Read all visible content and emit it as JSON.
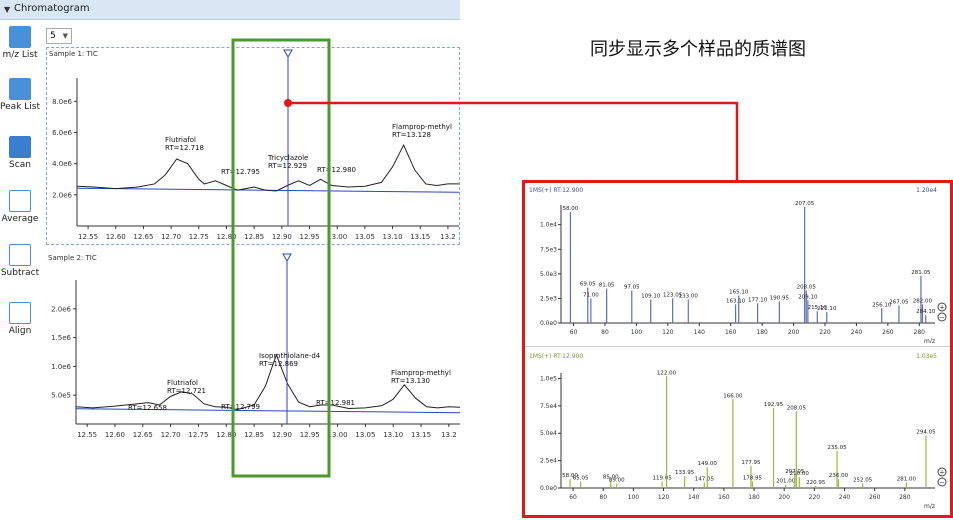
{
  "window": {
    "title": "Chromatogram"
  },
  "toolbar": {
    "items": [
      {
        "label": "m/z List",
        "icon": "mz-list-icon"
      },
      {
        "label": "Peak List",
        "icon": "peak-list-icon"
      },
      {
        "label": "Scan",
        "icon": "scan-icon"
      },
      {
        "label": "Average",
        "icon": "average-icon"
      },
      {
        "label": "Subtract",
        "icon": "subtract-icon"
      },
      {
        "label": "Align",
        "icon": "align-icon"
      }
    ]
  },
  "sample_count": {
    "value": "5"
  },
  "heading": "同步显示多个样品的质谱图",
  "colors": {
    "accent": "#4a90d9",
    "green_box": "#4a9a2e",
    "red_box": "#e0181c",
    "ms2_line": "#9ab83a"
  },
  "chart_data": [
    {
      "type": "line",
      "title": "Sample 1: TIC",
      "x_ticks": [
        "12.55",
        "12.60",
        "12.65",
        "12.70",
        "12.75",
        "12.80",
        "12.85",
        "12.90",
        "12.95",
        "13.00",
        "13.05",
        "13.10",
        "13.15",
        "13.2"
      ],
      "y_ticks": [
        "2.0e6",
        "4.0e6",
        "6.0e6",
        "8.0e6"
      ],
      "xlim": [
        12.53,
        13.22
      ],
      "ylim": [
        0,
        9500000
      ],
      "series": [
        {
          "x": [
            12.53,
            12.56,
            12.6,
            12.64,
            12.67,
            12.69,
            12.71,
            12.73,
            12.75,
            12.76,
            12.78,
            12.8,
            12.82,
            12.85,
            12.87,
            12.89,
            12.91,
            12.93,
            12.95,
            12.97,
            12.99,
            13.02,
            13.05,
            13.08,
            13.1,
            13.12,
            13.14,
            13.16,
            13.18,
            13.2,
            13.22
          ],
          "y": [
            2550000,
            2500000,
            2400000,
            2500000,
            2700000,
            3300000,
            4300000,
            4000000,
            3000000,
            2700000,
            2900000,
            2600000,
            2300000,
            2500000,
            2300000,
            2250000,
            2600000,
            2900000,
            2600000,
            3000000,
            2600000,
            2500000,
            2550000,
            2800000,
            3800000,
            5200000,
            3600000,
            2700000,
            2600000,
            2700000,
            2700000
          ]
        }
      ],
      "annotations": [
        {
          "name": "Flutriafol",
          "rt": "RT=12.718"
        },
        {
          "name": "",
          "rt": "RT=12.795"
        },
        {
          "name": "Tricyclazole",
          "rt": "RT=12.929"
        },
        {
          "name": "",
          "rt": "RT=12.980"
        },
        {
          "name": "Flamprop-methyl",
          "rt": "RT=13.128"
        }
      ]
    },
    {
      "type": "line",
      "title": "Sample 2: TIC",
      "x_ticks": [
        "12.55",
        "12.60",
        "12.65",
        "12.70",
        "12.75",
        "12.80",
        "12.85",
        "12.90",
        "12.95",
        "13.00",
        "13.05",
        "13.10",
        "13.15",
        "13.2"
      ],
      "y_ticks": [
        "5.0e5",
        "1.0e6",
        "1.5e6",
        "2.0e6"
      ],
      "xlim": [
        12.53,
        13.22
      ],
      "ylim": [
        0,
        2500000
      ],
      "series": [
        {
          "x": [
            12.53,
            12.56,
            12.6,
            12.64,
            12.66,
            12.68,
            12.7,
            12.72,
            12.74,
            12.76,
            12.78,
            12.8,
            12.82,
            12.85,
            12.87,
            12.89,
            12.91,
            12.93,
            12.95,
            12.97,
            12.99,
            13.02,
            13.05,
            13.08,
            13.1,
            13.12,
            13.14,
            13.16,
            13.18,
            13.2,
            13.22
          ],
          "y": [
            300000,
            280000,
            310000,
            350000,
            370000,
            330000,
            480000,
            560000,
            520000,
            350000,
            300000,
            290000,
            250000,
            330000,
            650000,
            1200000,
            700000,
            380000,
            300000,
            330000,
            330000,
            270000,
            280000,
            320000,
            430000,
            680000,
            450000,
            300000,
            280000,
            300000,
            290000
          ]
        }
      ],
      "annotations": [
        {
          "name": "",
          "rt": "RT=12.658"
        },
        {
          "name": "Flutriafol",
          "rt": "RT=12.721"
        },
        {
          "name": "",
          "rt": "RT=12.799"
        },
        {
          "name": "Isoprothiolane-d4",
          "rt": "RT=12.869"
        },
        {
          "name": "",
          "rt": "RT=12.981"
        },
        {
          "name": "Flamprop-methyl",
          "rt": "RT=13.130"
        }
      ]
    },
    {
      "type": "bar",
      "title": "1MS(+) RT:12.900",
      "max_label": "1.20e4",
      "xlabel": "m/z",
      "x_ticks": [
        "60",
        "80",
        "100",
        "120",
        "140",
        "160",
        "180",
        "200",
        "220",
        "240",
        "260",
        "280"
      ],
      "y_ticks": [
        "0.0e0",
        "2.5e3",
        "5.0e3",
        "7.5e3",
        "1.0e4"
      ],
      "xlim": [
        52,
        290
      ],
      "ylim": [
        0,
        12000
      ],
      "peaks": [
        {
          "mz": 58.0,
          "i": 11300,
          "label": "58.00"
        },
        {
          "mz": 69.05,
          "i": 3600,
          "label": "69.05"
        },
        {
          "mz": 71.0,
          "i": 2500,
          "label": "71.00"
        },
        {
          "mz": 81.05,
          "i": 3500,
          "label": "81.05"
        },
        {
          "mz": 97.05,
          "i": 3300,
          "label": "97.05"
        },
        {
          "mz": 109.1,
          "i": 2400,
          "label": "109.10"
        },
        {
          "mz": 123.05,
          "i": 2500,
          "label": "123.05"
        },
        {
          "mz": 133.0,
          "i": 2400,
          "label": "133.00"
        },
        {
          "mz": 163.1,
          "i": 1900,
          "label": "163.10"
        },
        {
          "mz": 165.1,
          "i": 2800,
          "label": "165.10"
        },
        {
          "mz": 177.1,
          "i": 2000,
          "label": "177.10"
        },
        {
          "mz": 190.95,
          "i": 2200,
          "label": "190.95"
        },
        {
          "mz": 207.05,
          "i": 11800,
          "label": "207.05"
        },
        {
          "mz": 208.05,
          "i": 3300,
          "label": "208.05"
        },
        {
          "mz": 209.1,
          "i": 2300,
          "label": "209.10"
        },
        {
          "mz": 215.1,
          "i": 1200,
          "label": "215.10"
        },
        {
          "mz": 221.1,
          "i": 1100,
          "label": "221.10"
        },
        {
          "mz": 256.1,
          "i": 1500,
          "label": "256.10"
        },
        {
          "mz": 267.05,
          "i": 1800,
          "label": "267.05"
        },
        {
          "mz": 281.05,
          "i": 4800,
          "label": "281.05"
        },
        {
          "mz": 282.0,
          "i": 1900,
          "label": "282.00"
        },
        {
          "mz": 284.1,
          "i": 800,
          "label": "284.10"
        }
      ]
    },
    {
      "type": "bar",
      "title": "1MS(+) RT:12.900",
      "max_label": "1.03e5",
      "xlabel": "m/z",
      "x_ticks": [
        "60",
        "80",
        "100",
        "120",
        "140",
        "160",
        "180",
        "200",
        "220",
        "240",
        "260",
        "280"
      ],
      "y_ticks": [
        "0.0e0",
        "2.5e4",
        "5.0e4",
        "7.5e4",
        "1.0e5"
      ],
      "xlim": [
        52,
        300
      ],
      "ylim": [
        0,
        105000
      ],
      "peaks": [
        {
          "mz": 58.0,
          "i": 8000,
          "label": "58.00"
        },
        {
          "mz": 65.05,
          "i": 6000,
          "label": "65.05"
        },
        {
          "mz": 85.0,
          "i": 7000,
          "label": "85.00"
        },
        {
          "mz": 89.0,
          "i": 4000,
          "label": "89.00"
        },
        {
          "mz": 119.05,
          "i": 6000,
          "label": "119.05"
        },
        {
          "mz": 122.0,
          "i": 102000,
          "label": "122.00"
        },
        {
          "mz": 133.95,
          "i": 11000,
          "label": "133.95"
        },
        {
          "mz": 147.05,
          "i": 5000,
          "label": "147.05"
        },
        {
          "mz": 149.0,
          "i": 19000,
          "label": "149.00"
        },
        {
          "mz": 166.0,
          "i": 81000,
          "label": "166.00"
        },
        {
          "mz": 177.95,
          "i": 20000,
          "label": "177.95"
        },
        {
          "mz": 178.95,
          "i": 6000,
          "label": "178.95"
        },
        {
          "mz": 192.95,
          "i": 73000,
          "label": "192.95"
        },
        {
          "mz": 201.0,
          "i": 3000,
          "label": "201.00"
        },
        {
          "mz": 207.05,
          "i": 12000,
          "label": "207.05"
        },
        {
          "mz": 208.05,
          "i": 70000,
          "label": "208.05"
        },
        {
          "mz": 210.0,
          "i": 10000,
          "label": "210.00"
        },
        {
          "mz": 220.95,
          "i": 2000,
          "label": "220.95"
        },
        {
          "mz": 235.05,
          "i": 34000,
          "label": "235.05"
        },
        {
          "mz": 236.0,
          "i": 8000,
          "label": "236.00"
        },
        {
          "mz": 252.05,
          "i": 4000,
          "label": "252.05"
        },
        {
          "mz": 281.0,
          "i": 5000,
          "label": "281.00"
        },
        {
          "mz": 294.05,
          "i": 48000,
          "label": "294.05"
        }
      ]
    }
  ]
}
